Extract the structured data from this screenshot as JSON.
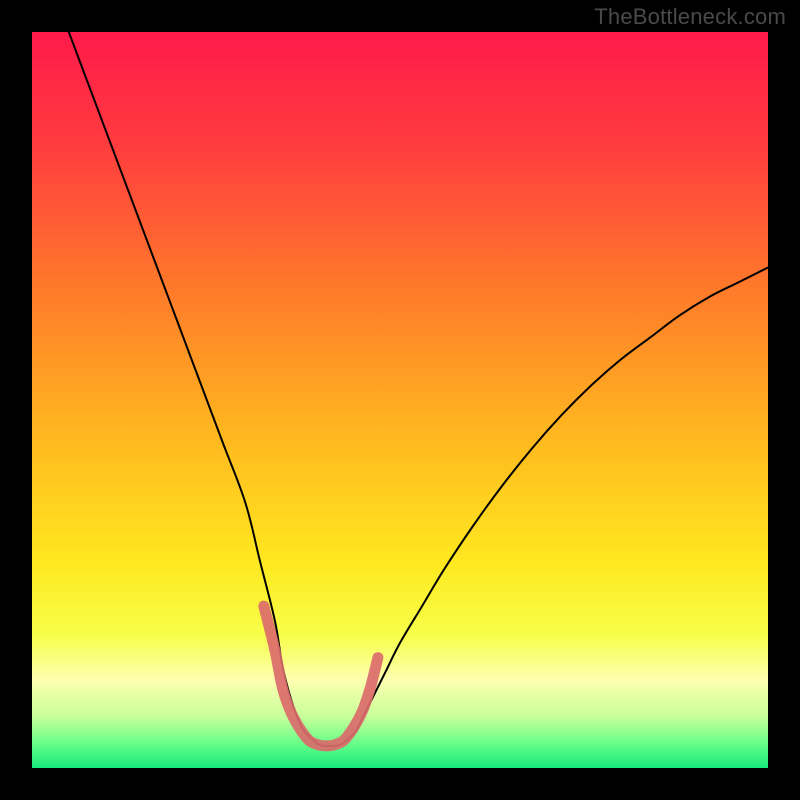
{
  "watermark": "TheBottleneck.com",
  "chart_data": {
    "type": "line",
    "title": "",
    "xlabel": "",
    "ylabel": "",
    "xlim": [
      0,
      100
    ],
    "ylim": [
      0,
      100
    ],
    "grid": false,
    "legend": false,
    "annotations": [],
    "background_gradient": {
      "stops": [
        {
          "offset": 0.0,
          "color": "#ff1a4b"
        },
        {
          "offset": 0.15,
          "color": "#ff3b3f"
        },
        {
          "offset": 0.35,
          "color": "#ff7a2a"
        },
        {
          "offset": 0.55,
          "color": "#ffb81f"
        },
        {
          "offset": 0.72,
          "color": "#ffe81f"
        },
        {
          "offset": 0.82,
          "color": "#f7ff4a"
        },
        {
          "offset": 0.88,
          "color": "#fdffb0"
        },
        {
          "offset": 0.93,
          "color": "#c8ff9a"
        },
        {
          "offset": 0.965,
          "color": "#6cff8a"
        },
        {
          "offset": 1.0,
          "color": "#17e87b"
        }
      ]
    },
    "series": [
      {
        "name": "main-curve",
        "color": "#000000",
        "stroke_width": 2.0,
        "x": [
          5,
          8,
          11,
          14,
          17,
          20,
          23,
          26,
          29,
          31,
          33,
          34,
          35,
          36,
          37,
          38,
          39,
          40,
          41,
          42,
          43,
          44,
          45,
          46,
          48,
          50,
          53,
          56,
          60,
          64,
          68,
          72,
          76,
          80,
          84,
          88,
          92,
          96,
          100
        ],
        "y": [
          100,
          92,
          84,
          76,
          68,
          60,
          52,
          44,
          36,
          28,
          20,
          14,
          10,
          7,
          5,
          4,
          3.2,
          3,
          3,
          3.2,
          4,
          5,
          7,
          9,
          13,
          17,
          22,
          27,
          33,
          38.5,
          43.5,
          48,
          52,
          55.5,
          58.5,
          61.5,
          64,
          66,
          68
        ]
      },
      {
        "name": "highlight-band",
        "color": "#db6b6b",
        "stroke_width": 11,
        "linecap": "round",
        "x": [
          31.5,
          33,
          34,
          35,
          36,
          37,
          38,
          40,
          42,
          43,
          44,
          45,
          46,
          47
        ],
        "y": [
          22,
          16,
          11,
          8,
          6,
          4.5,
          3.5,
          3,
          3.5,
          4.5,
          6,
          8,
          11,
          15
        ]
      }
    ]
  }
}
